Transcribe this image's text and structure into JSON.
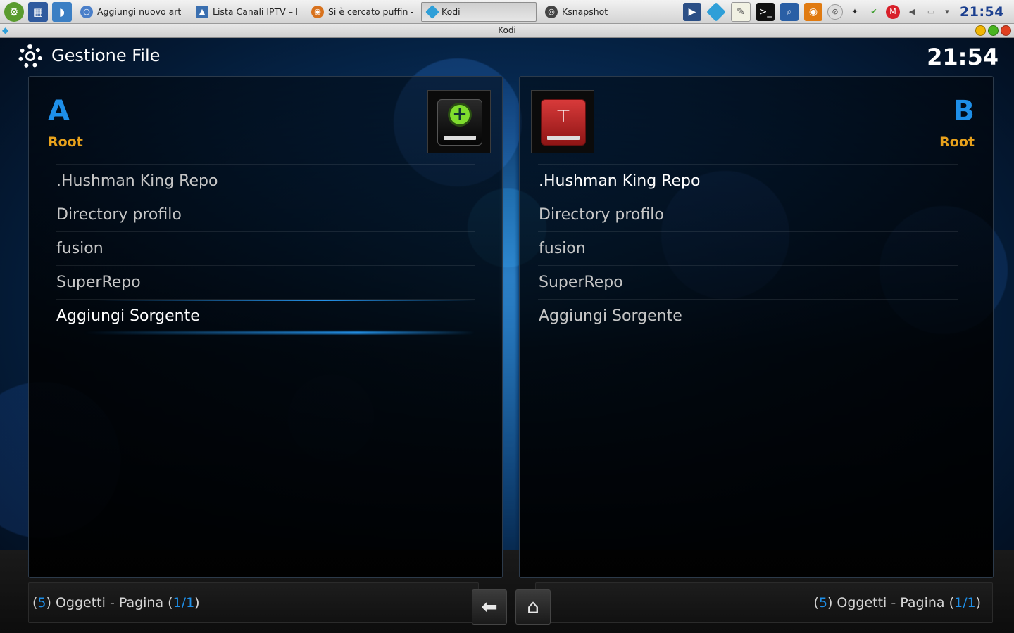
{
  "taskbar": {
    "tasks": [
      {
        "label": "Aggiungi nuovo artico",
        "icon": "chromium-icon",
        "active": false
      },
      {
        "label": "Lista Canali IPTV – Dol",
        "icon": "image-icon",
        "active": false
      },
      {
        "label": "Si è cercato puffin - - I",
        "icon": "firefox-icon",
        "active": false
      },
      {
        "label": "Kodi",
        "icon": "kodi-icon",
        "active": true
      },
      {
        "label": "Ksnapshot",
        "icon": "camera-icon",
        "active": false
      }
    ],
    "clock": "21:54"
  },
  "window": {
    "title": "Kodi"
  },
  "kodi": {
    "header_title": "Gestione File",
    "clock": "21:54",
    "left_pane": {
      "letter": "A",
      "path": "Root",
      "items": [
        ".Hushman King Repo",
        "Directory profilo",
        "fusion",
        "SuperRepo",
        "Aggiungi Sorgente"
      ],
      "focused_index": 4
    },
    "right_pane": {
      "letter": "B",
      "path": "Root",
      "items": [
        ".Hushman King Repo",
        "Directory profilo",
        "fusion",
        "SuperRepo",
        "Aggiungi Sorgente"
      ]
    },
    "status_left": {
      "open": "(",
      "count": "5",
      "mid": ") Oggetti - Pagina (",
      "page": "1/1",
      "close": ")"
    },
    "status_right": {
      "open": "(",
      "count": "5",
      "mid": ") Oggetti - Pagina (",
      "page": "1/1",
      "close": ")"
    },
    "back_icon": "back-arrow-icon",
    "home_icon": "home-icon",
    "colors": {
      "accent": "#1e8fe8",
      "path": "#e8a21c"
    }
  }
}
